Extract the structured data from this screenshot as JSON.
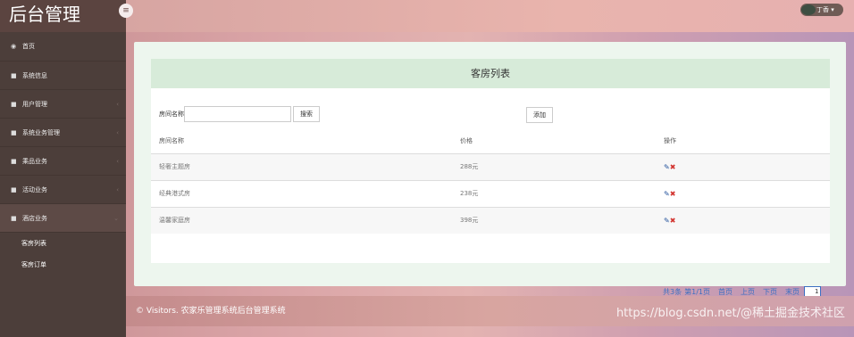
{
  "app": {
    "brand": "后台管理",
    "toggle_icon": "≡"
  },
  "user": {
    "name": "丁香"
  },
  "sidebar": {
    "items": [
      {
        "label": "首页",
        "icon": "dashboard-icon"
      },
      {
        "label": "系统信息",
        "icon": "book-icon"
      },
      {
        "label": "用户管理",
        "icon": "book-icon"
      },
      {
        "label": "系统业务管理",
        "icon": "book-icon"
      },
      {
        "label": "乘品业务",
        "icon": "book-icon"
      },
      {
        "label": "活动业务",
        "icon": "book-icon"
      },
      {
        "label": "酒店业务",
        "icon": "book-icon"
      }
    ],
    "subitems": [
      {
        "label": "客房列表"
      },
      {
        "label": "客房订单"
      }
    ]
  },
  "panel": {
    "title": "客房列表",
    "search_label": "房间名称",
    "search_value": "",
    "search_button": "搜索",
    "add_button": "添加"
  },
  "table": {
    "headers": [
      "房间名称",
      "价格",
      "操作"
    ],
    "rows": [
      {
        "name": "轻奢主题房",
        "price": "288元"
      },
      {
        "name": "经典港式房",
        "price": "238元"
      },
      {
        "name": "温馨家庭房",
        "price": "398元"
      }
    ]
  },
  "pager": {
    "summary": "共3条",
    "page_info": "第1/1页",
    "first": "首页",
    "prev": "上页",
    "next": "下页",
    "last": "末页",
    "selected": "1"
  },
  "footer": {
    "text": "© Visitors. 农家乐管理系统后台管理系统"
  },
  "watermark": {
    "text": "https://blog.csdn.net/@稀土掘金技术社区"
  }
}
